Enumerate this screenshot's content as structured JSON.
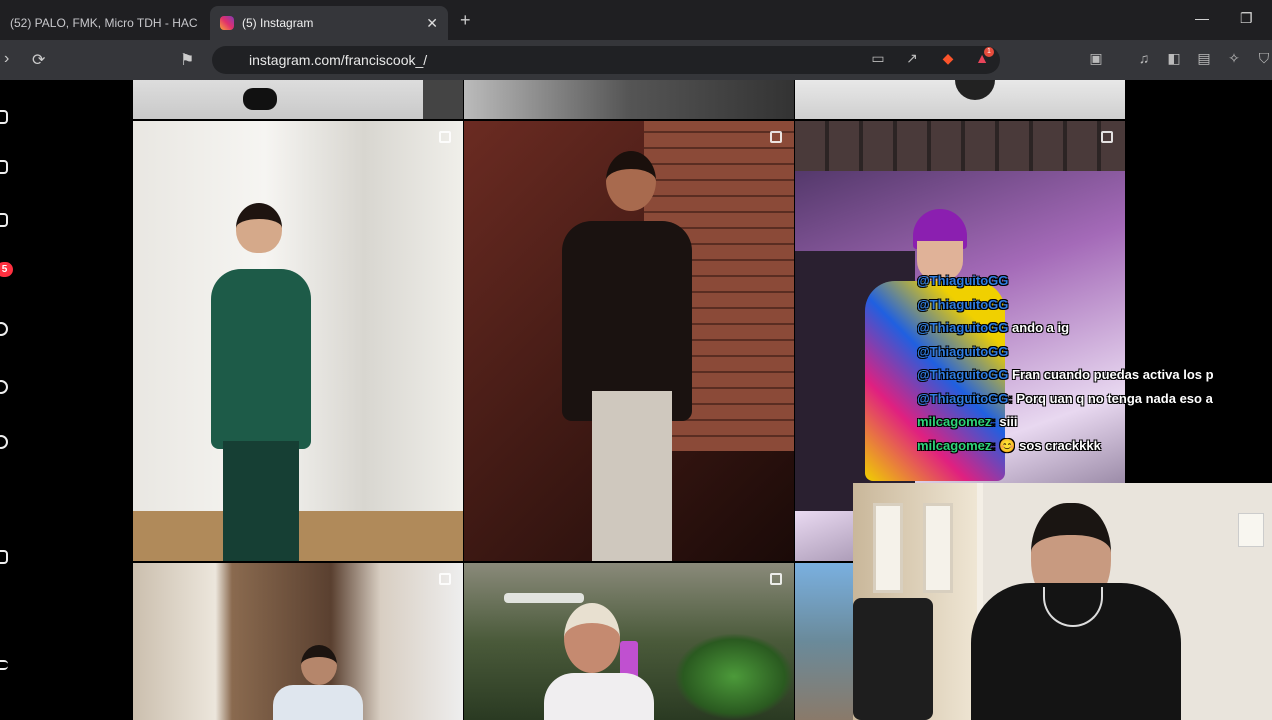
{
  "browser": {
    "tabs": [
      {
        "label": "(52) PALO, FMK, Micro TDH - HAC",
        "active": false
      },
      {
        "label": "(5) Instagram",
        "active": true
      }
    ],
    "url": "instagram.com/franciscook_/",
    "brave_badge": "1"
  },
  "instagram": {
    "notifications_count": "5"
  },
  "chat": [
    {
      "user": "@ThiaguitoGG",
      "text": "",
      "user_color": "#2f7de1"
    },
    {
      "user": "@ThiaguitoGG",
      "text": "",
      "user_color": "#2f7de1"
    },
    {
      "user": "@ThiaguitoGG",
      "text": "ando a ig",
      "user_color": "#2f7de1"
    },
    {
      "user": "@ThiaguitoGG",
      "text": "",
      "user_color": "#2f7de1"
    },
    {
      "user": "@ThiaguitoGG",
      "text": "Fran cuando puedas activa los p",
      "user_color": "#2f7de1"
    },
    {
      "user": "@ThiaguitoGG",
      "text": "Porq uan q no tenga nada eso a",
      "user_color": "#2f7de1"
    },
    {
      "user": "milcagomez",
      "text": "siii",
      "user_color": "#2ed47a"
    },
    {
      "user": "milcagomez",
      "text": "😊 sos crackkkk",
      "user_color": "#2ed47a"
    }
  ]
}
